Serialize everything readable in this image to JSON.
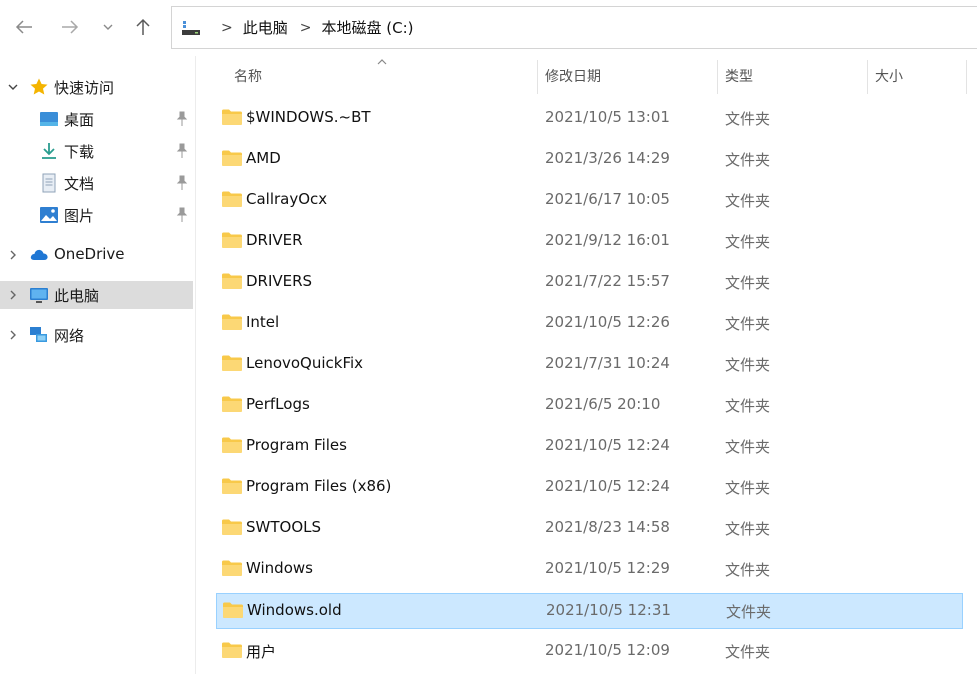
{
  "nav": {
    "back_icon": "arrow-left-icon",
    "forward_icon": "arrow-right-icon",
    "recent_icon": "chevron-down-icon",
    "up_icon": "arrow-up-icon"
  },
  "address": {
    "crumbs": [
      "此电脑",
      "本地磁盘 (C:)"
    ],
    "separator": ">"
  },
  "sidebar": {
    "quick_access": "快速访问",
    "pinned": [
      {
        "label": "桌面",
        "icon": "desktop-icon"
      },
      {
        "label": "下载",
        "icon": "download-icon"
      },
      {
        "label": "文档",
        "icon": "document-icon"
      },
      {
        "label": "图片",
        "icon": "pictures-icon"
      }
    ],
    "onedrive": "OneDrive",
    "this_pc": "此电脑",
    "network": "网络"
  },
  "columns": {
    "name": "名称",
    "date": "修改日期",
    "type": "类型",
    "size": "大小"
  },
  "files": [
    {
      "name": "$WINDOWS.~BT",
      "date": "2021/10/5 13:01",
      "type": "文件夹"
    },
    {
      "name": "AMD",
      "date": "2021/3/26 14:29",
      "type": "文件夹"
    },
    {
      "name": "CallrayOcx",
      "date": "2021/6/17 10:05",
      "type": "文件夹"
    },
    {
      "name": "DRIVER",
      "date": "2021/9/12 16:01",
      "type": "文件夹"
    },
    {
      "name": "DRIVERS",
      "date": "2021/7/22 15:57",
      "type": "文件夹"
    },
    {
      "name": "Intel",
      "date": "2021/10/5 12:26",
      "type": "文件夹"
    },
    {
      "name": "LenovoQuickFix",
      "date": "2021/7/31 10:24",
      "type": "文件夹"
    },
    {
      "name": "PerfLogs",
      "date": "2021/6/5 20:10",
      "type": "文件夹"
    },
    {
      "name": "Program Files",
      "date": "2021/10/5 12:24",
      "type": "文件夹"
    },
    {
      "name": "Program Files (x86)",
      "date": "2021/10/5 12:24",
      "type": "文件夹"
    },
    {
      "name": "SWTOOLS",
      "date": "2021/8/23 14:58",
      "type": "文件夹"
    },
    {
      "name": "Windows",
      "date": "2021/10/5 12:29",
      "type": "文件夹"
    },
    {
      "name": "Windows.old",
      "date": "2021/10/5 12:31",
      "type": "文件夹"
    },
    {
      "name": "用户",
      "date": "2021/10/5 12:09",
      "type": "文件夹"
    }
  ],
  "selected_file": "Windows.old",
  "colors": {
    "selection_bg": "#cce8ff",
    "selection_border": "#99d1ff",
    "folder": "#f8c94a",
    "sidebar_selected": "#dcdcdc"
  }
}
